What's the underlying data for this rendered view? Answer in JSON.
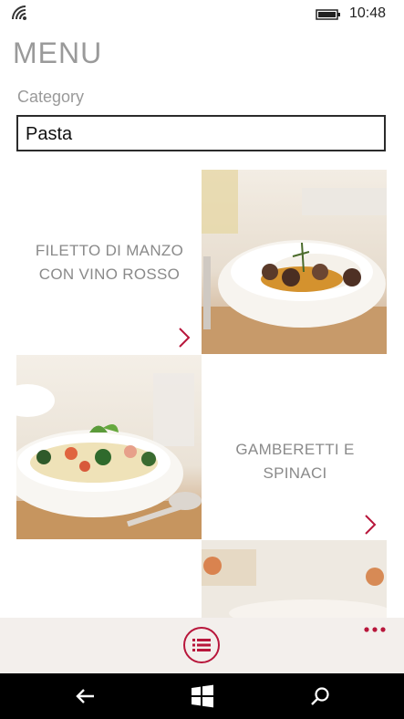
{
  "status_bar": {
    "time": "10:48",
    "icons": [
      "wifi-icon",
      "battery-icon"
    ]
  },
  "page": {
    "title": "MENU"
  },
  "category": {
    "label": "Category",
    "value": "Pasta"
  },
  "menu_items": [
    {
      "name": "FILETTO DI MANZO CON VINO ROSSO",
      "line1": "FILETTO DI MANZO",
      "line2": "CON VINO ROSSO",
      "icon": "chevron-right-icon"
    },
    {
      "name": "GAMBERETTI E SPINACI",
      "line1": "GAMBERETTI E SPINACI",
      "icon": "chevron-right-icon"
    }
  ],
  "app_bar": {
    "primary_icon": "list-icon",
    "more_icon": "more-icon"
  },
  "nav_bar": {
    "icons": [
      "back-icon",
      "windows-icon",
      "search-icon"
    ]
  },
  "colors": {
    "accent": "#b8163b",
    "text_muted": "#8a8a8a",
    "app_bar_bg": "#f3efec"
  }
}
